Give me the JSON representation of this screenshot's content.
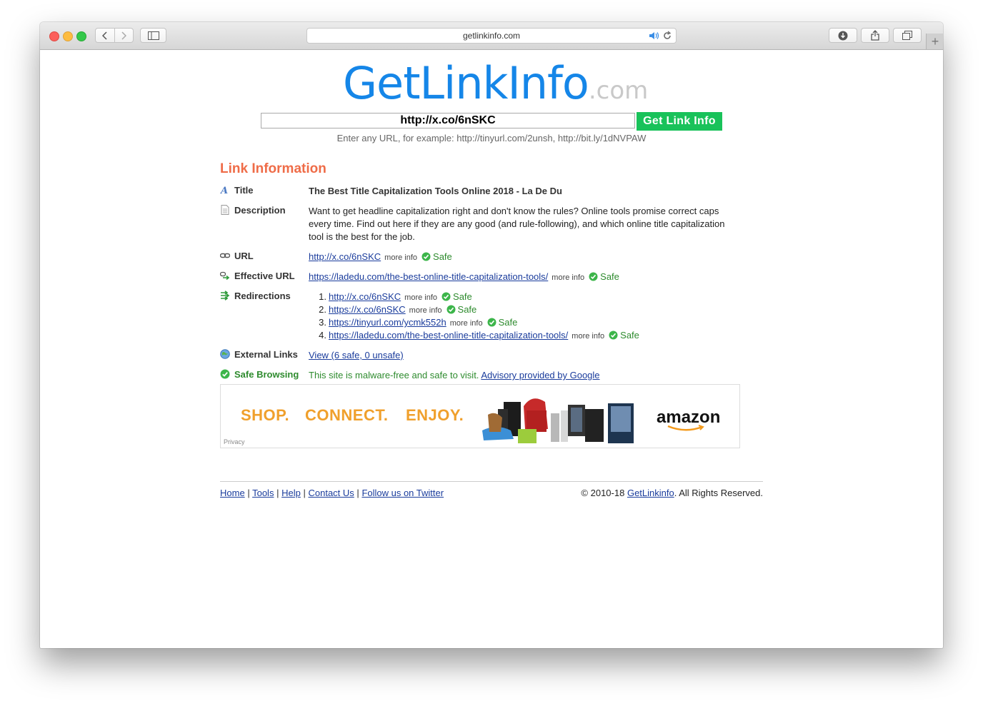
{
  "browser": {
    "address": "getlinkinfo.com"
  },
  "logo": {
    "main": "GetLinkInfo",
    "suffix": ".com"
  },
  "search": {
    "value": "http://x.co/6nSKC",
    "button_label": "Get Link Info",
    "hint": "Enter any URL, for example: http://tinyurl.com/2unsh, http://bit.ly/1dNVPAW"
  },
  "info": {
    "section_title": "Link Information",
    "title_label": "Title",
    "title_value": "The Best Title Capitalization Tools Online 2018 - La De Du",
    "description_label": "Description",
    "description_value": "Want to get headline capitalization right and don't know the rules? Online tools promise correct caps every time. Find out here if they are any good (and rule-following), and which online title capitalization tool is the best for the job.",
    "url_label": "URL",
    "url_value": "http://x.co/6nSKC",
    "effective_label": "Effective URL",
    "effective_value": "https://ladedu.com/the-best-online-title-capitalization-tools/",
    "redirections_label": "Redirections",
    "redirections": [
      {
        "num": "1.",
        "url": "http://x.co/6nSKC"
      },
      {
        "num": "2.",
        "url": "https://x.co/6nSKC"
      },
      {
        "num": "3.",
        "url": "https://tinyurl.com/ycmk552h"
      },
      {
        "num": "4.",
        "url": "https://ladedu.com/the-best-online-title-capitalization-tools/"
      }
    ],
    "external_label": "External Links",
    "external_value": "View (6 safe, 0 unsafe)",
    "safe_browsing_label": "Safe Browsing",
    "safe_browsing_text": "This site is malware-free and safe to visit.",
    "safe_browsing_link": "Advisory provided by Google",
    "more_info": "more info",
    "safe": "Safe"
  },
  "ad": {
    "shop": "SHOP.",
    "connect": "CONNECT.",
    "enjoy": "ENJOY.",
    "brand": "amazon",
    "privacy": "Privacy"
  },
  "footer": {
    "home": "Home",
    "tools": "Tools",
    "help": "Help",
    "contact": "Contact Us",
    "twitter": "Follow us on Twitter",
    "sep": "|",
    "copyright_prefix": "© 2010-18",
    "copyright_link": "GetLinkinfo",
    "copyright_suffix": ". All Rights Reserved."
  },
  "colors": {
    "logo_blue": "#1586e8",
    "button_green": "#19c25a",
    "section_orange": "#ef6c48",
    "safe_green": "#2e8b2e",
    "link_blue": "#1a3c9c"
  }
}
